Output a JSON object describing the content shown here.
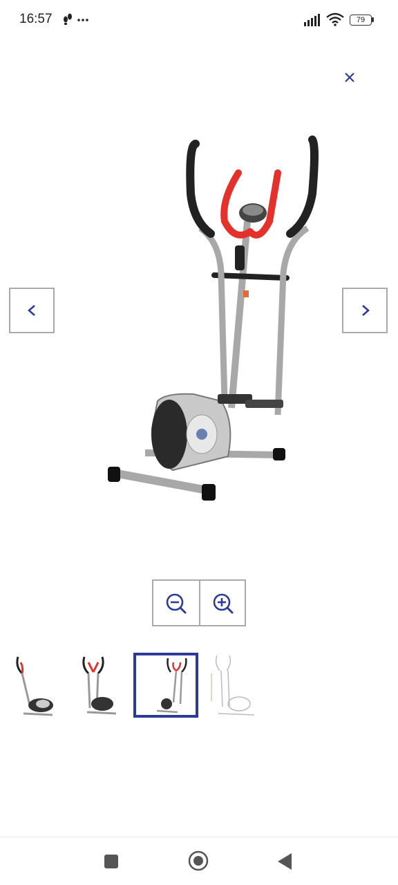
{
  "status_bar": {
    "time": "16:57",
    "notification_icons": [
      "footsteps-icon",
      "more-dots-icon"
    ],
    "battery_level": "79",
    "signal_icon": "signal-bars-icon",
    "wifi_icon": "wifi-icon"
  },
  "viewer": {
    "close_symbol": "×",
    "prev_icon": "chevron-left-icon",
    "next_icon": "chevron-right-icon",
    "zoom_out_icon": "zoom-out-icon",
    "zoom_in_icon": "zoom-in-icon",
    "accent_color": "#2c3b97",
    "thumbnails": [
      {
        "icon": "elliptical-trainer-side-thumbnail",
        "selected": false
      },
      {
        "icon": "elliptical-trainer-front-thumbnail",
        "selected": false
      },
      {
        "icon": "elliptical-trainer-angle-thumbnail",
        "selected": true
      },
      {
        "icon": "elliptical-trainer-dimensions-thumbnail",
        "selected": false
      }
    ]
  },
  "android_nav": {
    "recents_icon": "square-icon",
    "home_icon": "circle-home-icon",
    "back_icon": "triangle-back-icon"
  }
}
